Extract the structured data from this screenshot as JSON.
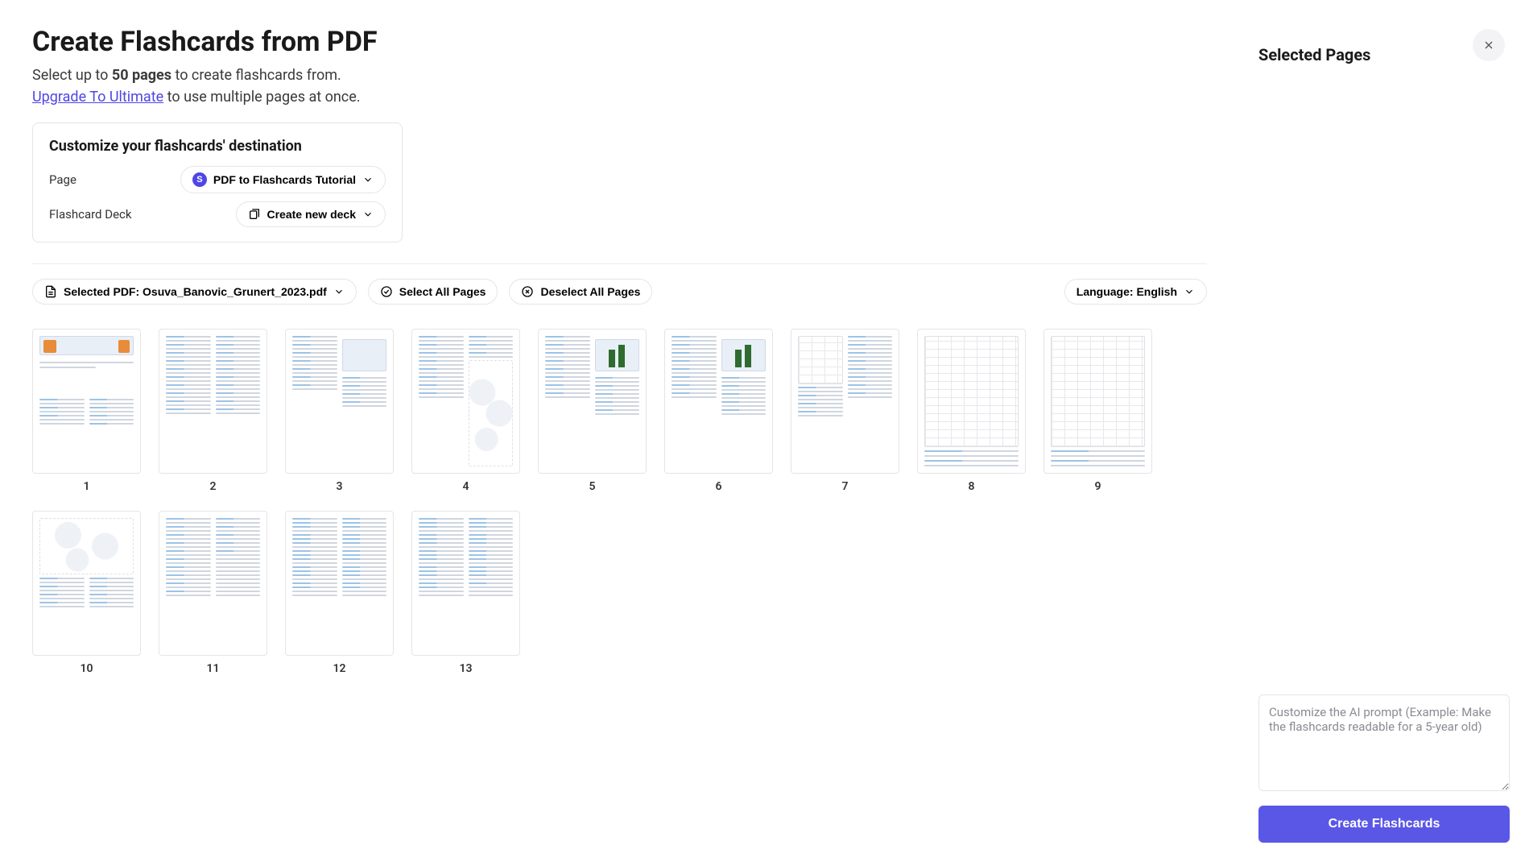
{
  "header": {
    "title": "Create Flashcards from PDF",
    "subtitle_pre": "Select up to ",
    "subtitle_bold": "50 pages",
    "subtitle_post": " to create flashcards from.",
    "upgrade_link": "Upgrade To Ultimate",
    "upgrade_post": " to use multiple pages at once."
  },
  "destination": {
    "title": "Customize your flashcards' destination",
    "page_label": "Page",
    "page_value": "PDF to Flashcards Tutorial",
    "page_badge": "S",
    "deck_label": "Flashcard Deck",
    "deck_value": "Create new deck"
  },
  "toolbar": {
    "selected_pdf_prefix": "Selected PDF: ",
    "selected_pdf_name": "Osuva_Banovic_Grunert_2023.pdf",
    "select_all": "Select All Pages",
    "deselect_all": "Deselect All Pages",
    "language_prefix": "Language: ",
    "language_value": "English"
  },
  "pages": [
    1,
    2,
    3,
    4,
    5,
    6,
    7,
    8,
    9,
    10,
    11,
    12,
    13
  ],
  "sidebar": {
    "title": "Selected Pages"
  },
  "prompt": {
    "placeholder": "Customize the AI prompt (Example: Make the flashcards readable for a 5-year old)"
  },
  "buttons": {
    "create": "Create Flashcards"
  }
}
